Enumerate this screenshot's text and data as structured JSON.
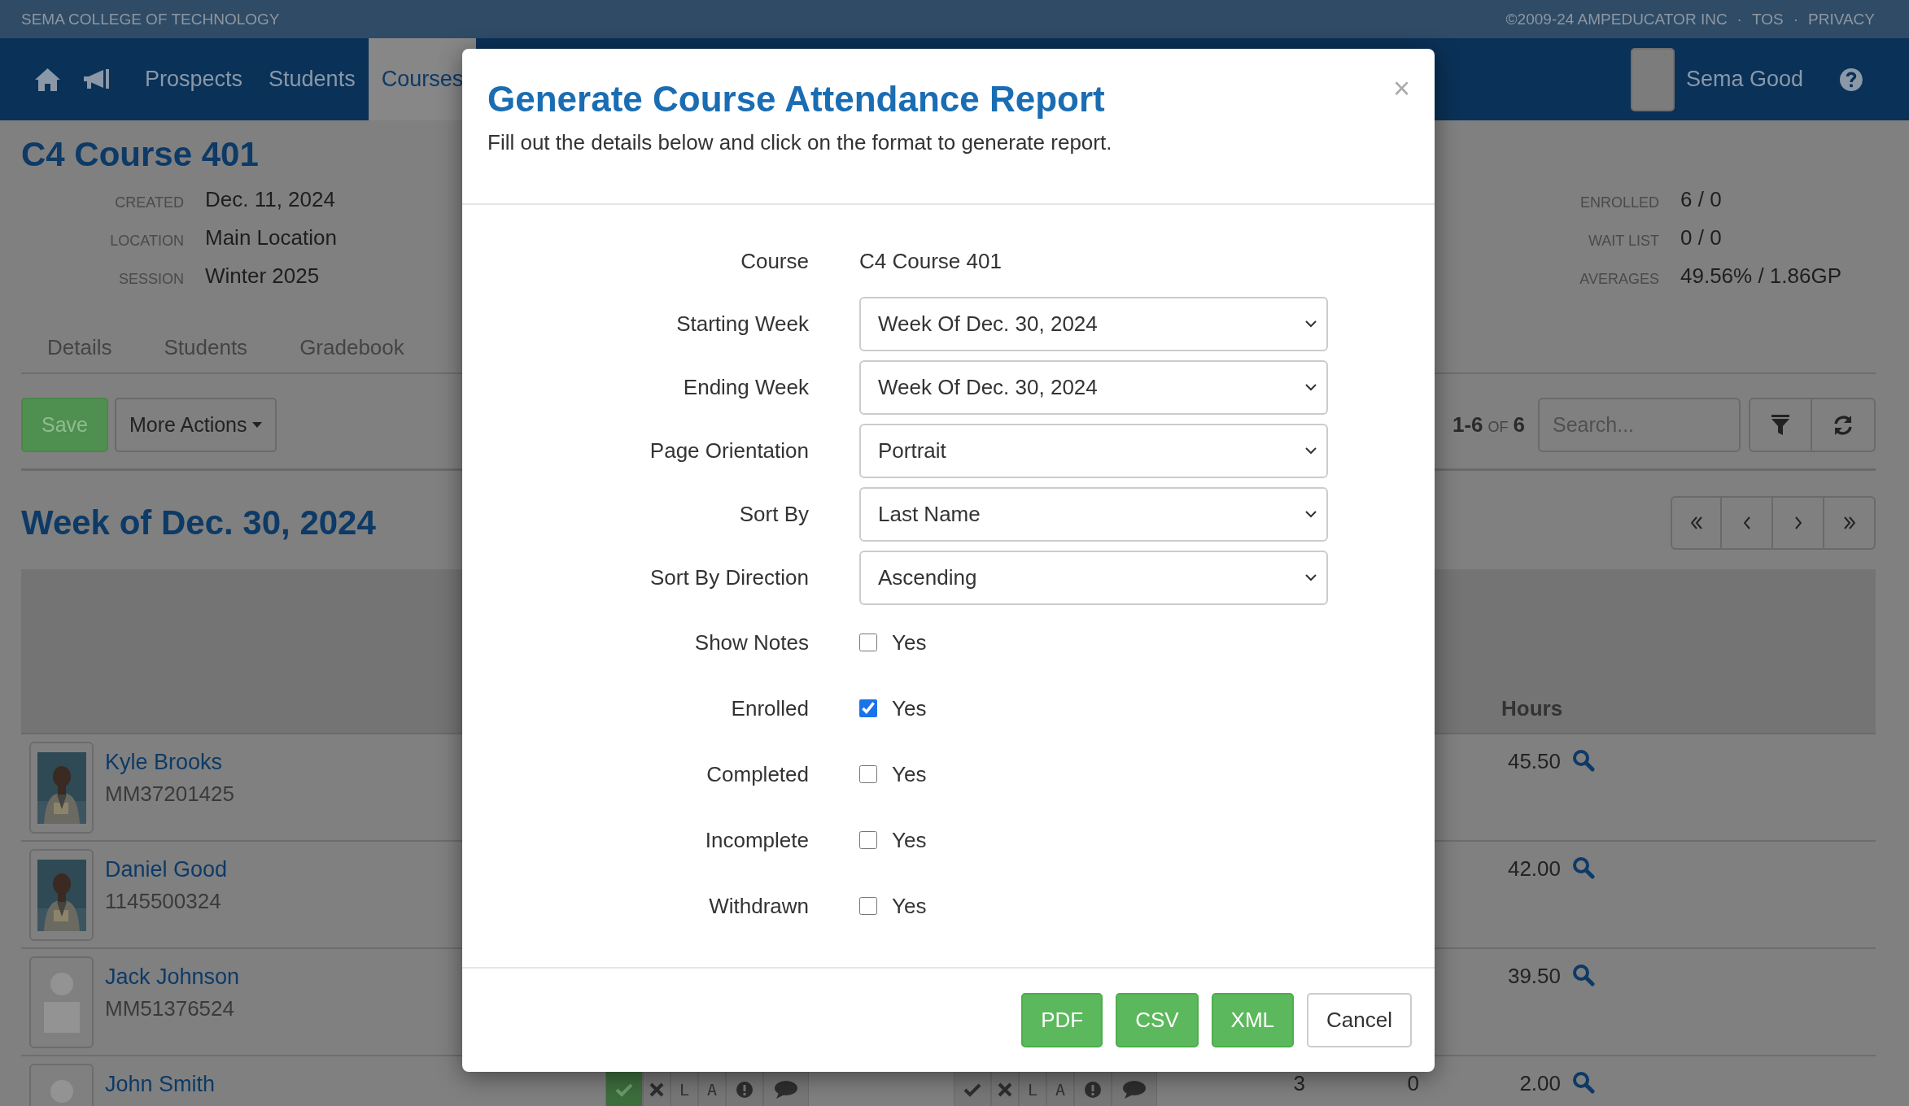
{
  "top_bar": {
    "school": "SEMA COLLEGE OF TECHNOLOGY",
    "items": [
      "©2009-24 AMPEDUCATOR INC",
      "·",
      "TOS",
      "·",
      "PRIVACY"
    ]
  },
  "nav": {
    "links": [
      {
        "label": "Prospects",
        "selected": false
      },
      {
        "label": "Students",
        "selected": false
      },
      {
        "label": "Courses",
        "selected": true
      }
    ],
    "user": "Sema Good"
  },
  "course": {
    "title": "C4 Course 401",
    "info_left": [
      {
        "label": "CREATED",
        "value": "Dec. 11, 2024"
      },
      {
        "label": "LOCATION",
        "value": "Main Location"
      },
      {
        "label": "SESSION",
        "value": "Winter 2025"
      }
    ],
    "info_right": [
      {
        "label": "ENROLLED",
        "value": "6 / 0"
      },
      {
        "label": "WAIT LIST",
        "value": "0 / 0"
      },
      {
        "label": "AVERAGES",
        "value": "49.56% / 1.86GP"
      }
    ]
  },
  "tabs": [
    "Details",
    "Students",
    "Gradebook"
  ],
  "toolbar": {
    "save": "Save",
    "more_actions": "More Actions",
    "count_range": "1-6",
    "count_of": "OF",
    "count_total": "6",
    "search_placeholder": "Search..."
  },
  "week_heading": "Week of Dec. 30, 2024",
  "table": {
    "hours_header": "Hours",
    "rows": [
      {
        "name": "Kyle Brooks",
        "id": "MM37201425",
        "hours": "45.50"
      },
      {
        "name": "Daniel Good",
        "id": "1145500324",
        "hours": "42.00"
      },
      {
        "name": "Jack Johnson",
        "id": "MM51376524",
        "photo": {
          "kind": "placeholder"
        },
        "hours": "39.50"
      },
      {
        "name": "John Smith",
        "photo": {
          "kind": "placeholder"
        },
        "hours": "2.00",
        "column_3": "3",
        "column_4": "0",
        "attendance": [
          [
            {
              "kind": "check",
              "selected": true
            },
            {
              "kind": "cross",
              "selected": false
            },
            {
              "kind": "letter",
              "label": "L",
              "selected": false
            },
            {
              "kind": "letter",
              "label": "A",
              "selected": false
            },
            {
              "kind": "alert",
              "selected": false
            },
            {
              "kind": "comment",
              "selected": false
            }
          ],
          [
            {
              "kind": "check",
              "selected": false
            },
            {
              "kind": "cross",
              "selected": false
            },
            {
              "kind": "letter",
              "label": "L",
              "selected": false
            },
            {
              "kind": "letter",
              "label": "A",
              "selected": false
            },
            {
              "kind": "alert",
              "selected": false
            },
            {
              "kind": "comment",
              "selected": false
            }
          ]
        ]
      }
    ]
  },
  "modal": {
    "title": "Generate Course Attendance Report",
    "subtitle": "Fill out the details below and click on the format to generate report.",
    "close": "×",
    "fields": [
      {
        "kind": "text",
        "label": "Course",
        "value": "C4 Course 401"
      },
      {
        "kind": "select",
        "label": "Starting Week",
        "value": "Week Of Dec. 30, 2024"
      },
      {
        "kind": "select",
        "label": "Ending Week",
        "value": "Week Of Dec. 30, 2024"
      },
      {
        "kind": "select",
        "label": "Page Orientation",
        "value": "Portrait"
      },
      {
        "kind": "select",
        "label": "Sort By",
        "value": "Last Name"
      },
      {
        "kind": "select",
        "label": "Sort By Direction",
        "value": "Ascending"
      },
      {
        "kind": "checkbox",
        "label": "Show Notes",
        "option": "Yes",
        "checked": false
      },
      {
        "kind": "checkbox",
        "label": "Enrolled",
        "option": "Yes",
        "checked": true
      },
      {
        "kind": "checkbox",
        "label": "Completed",
        "option": "Yes",
        "checked": false
      },
      {
        "kind": "checkbox",
        "label": "Incomplete",
        "option": "Yes",
        "checked": false
      },
      {
        "kind": "checkbox",
        "label": "Withdrawn",
        "option": "Yes",
        "checked": false
      }
    ],
    "buttons": [
      {
        "label": "PDF",
        "kind": "primary"
      },
      {
        "label": "CSV",
        "kind": "primary"
      },
      {
        "label": "XML",
        "kind": "primary"
      },
      {
        "label": "Cancel",
        "kind": "default"
      }
    ]
  }
}
